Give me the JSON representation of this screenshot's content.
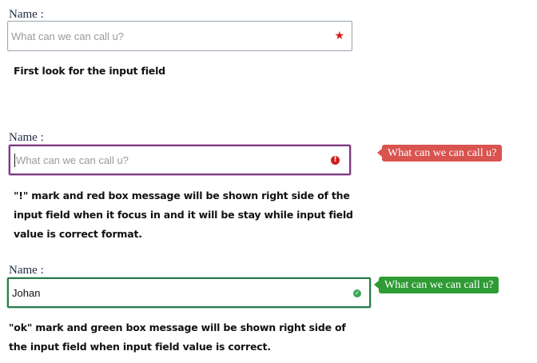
{
  "section_normal": {
    "label": "Name :",
    "placeholder": "What can we can call u?",
    "required_mark": "★",
    "caption": "First look for the input field"
  },
  "section_error": {
    "label": "Name :",
    "placeholder": "What can we can call u?",
    "status_mark": "!",
    "message": "What can we can call u?",
    "caption_lines": [
      "\"!\" mark and red box message will be shown right side of the",
      "input field when it focus in and it will be stay while input field",
      "value is correct format."
    ]
  },
  "section_ok": {
    "label": "Name :",
    "value": "Johan",
    "status_mark": "✓",
    "message": "What can we can call u?",
    "caption_lines": [
      "\"ok\" mark and green box message will be shown right side of",
      "the input field when input field value is correct."
    ]
  },
  "colors": {
    "error_bubble": "#d9534f",
    "ok_bubble": "#2e9b34",
    "required_star": "#e01717",
    "error_border": "#7b3a7f",
    "ok_border": "#2c7a4d"
  },
  "icons": {
    "required": "asterisk-star-icon",
    "error": "exclamation-circle-icon",
    "ok": "check-circle-icon"
  }
}
